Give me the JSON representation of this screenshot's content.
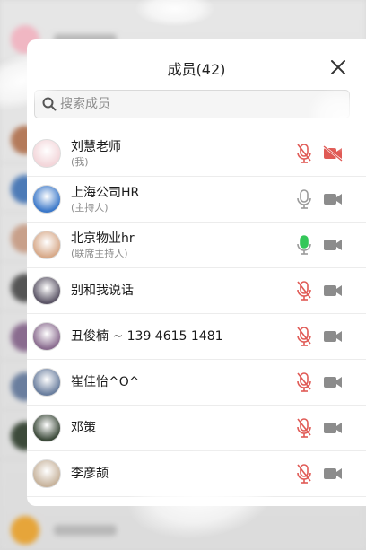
{
  "panel": {
    "title": "成员(42)",
    "close_icon": "close-icon",
    "search": {
      "placeholder": "搜索成员",
      "icon": "search-icon"
    }
  },
  "members": [
    {
      "name": "刘慧老师",
      "role": "(我)",
      "mic": "muted",
      "cam": "off",
      "avatar_color": "#f3d6da"
    },
    {
      "name": "上海公司HR",
      "role": "(主持人)",
      "mic": "idle",
      "cam": "on",
      "avatar_color": "#3b78c9"
    },
    {
      "name": "北京物业hr",
      "role": "(联席主持人)",
      "mic": "speaking",
      "cam": "on",
      "avatar_color": "#d7a989"
    },
    {
      "name": "别和我说话",
      "role": "",
      "mic": "muted",
      "cam": "on",
      "avatar_color": "#5b5566"
    },
    {
      "name": "丑俊楠 ~ 139 4615 1481",
      "role": "",
      "mic": "muted",
      "cam": "on",
      "avatar_color": "#8a6c8f"
    },
    {
      "name": "崔佳怡^O^",
      "role": "",
      "mic": "muted",
      "cam": "on",
      "avatar_color": "#6a7e9e"
    },
    {
      "name": "邓策",
      "role": "",
      "mic": "muted",
      "cam": "on",
      "avatar_color": "#3c4a3a"
    },
    {
      "name": "李彦颉",
      "role": "",
      "mic": "muted",
      "cam": "on",
      "avatar_color": "#c7b39c"
    }
  ],
  "colors": {
    "mic_muted": "#e05a55",
    "mic_idle": "#9a9a9a",
    "mic_speaking": "#34c759",
    "cam_on": "#8c8c8c",
    "cam_off": "#e05a55"
  }
}
